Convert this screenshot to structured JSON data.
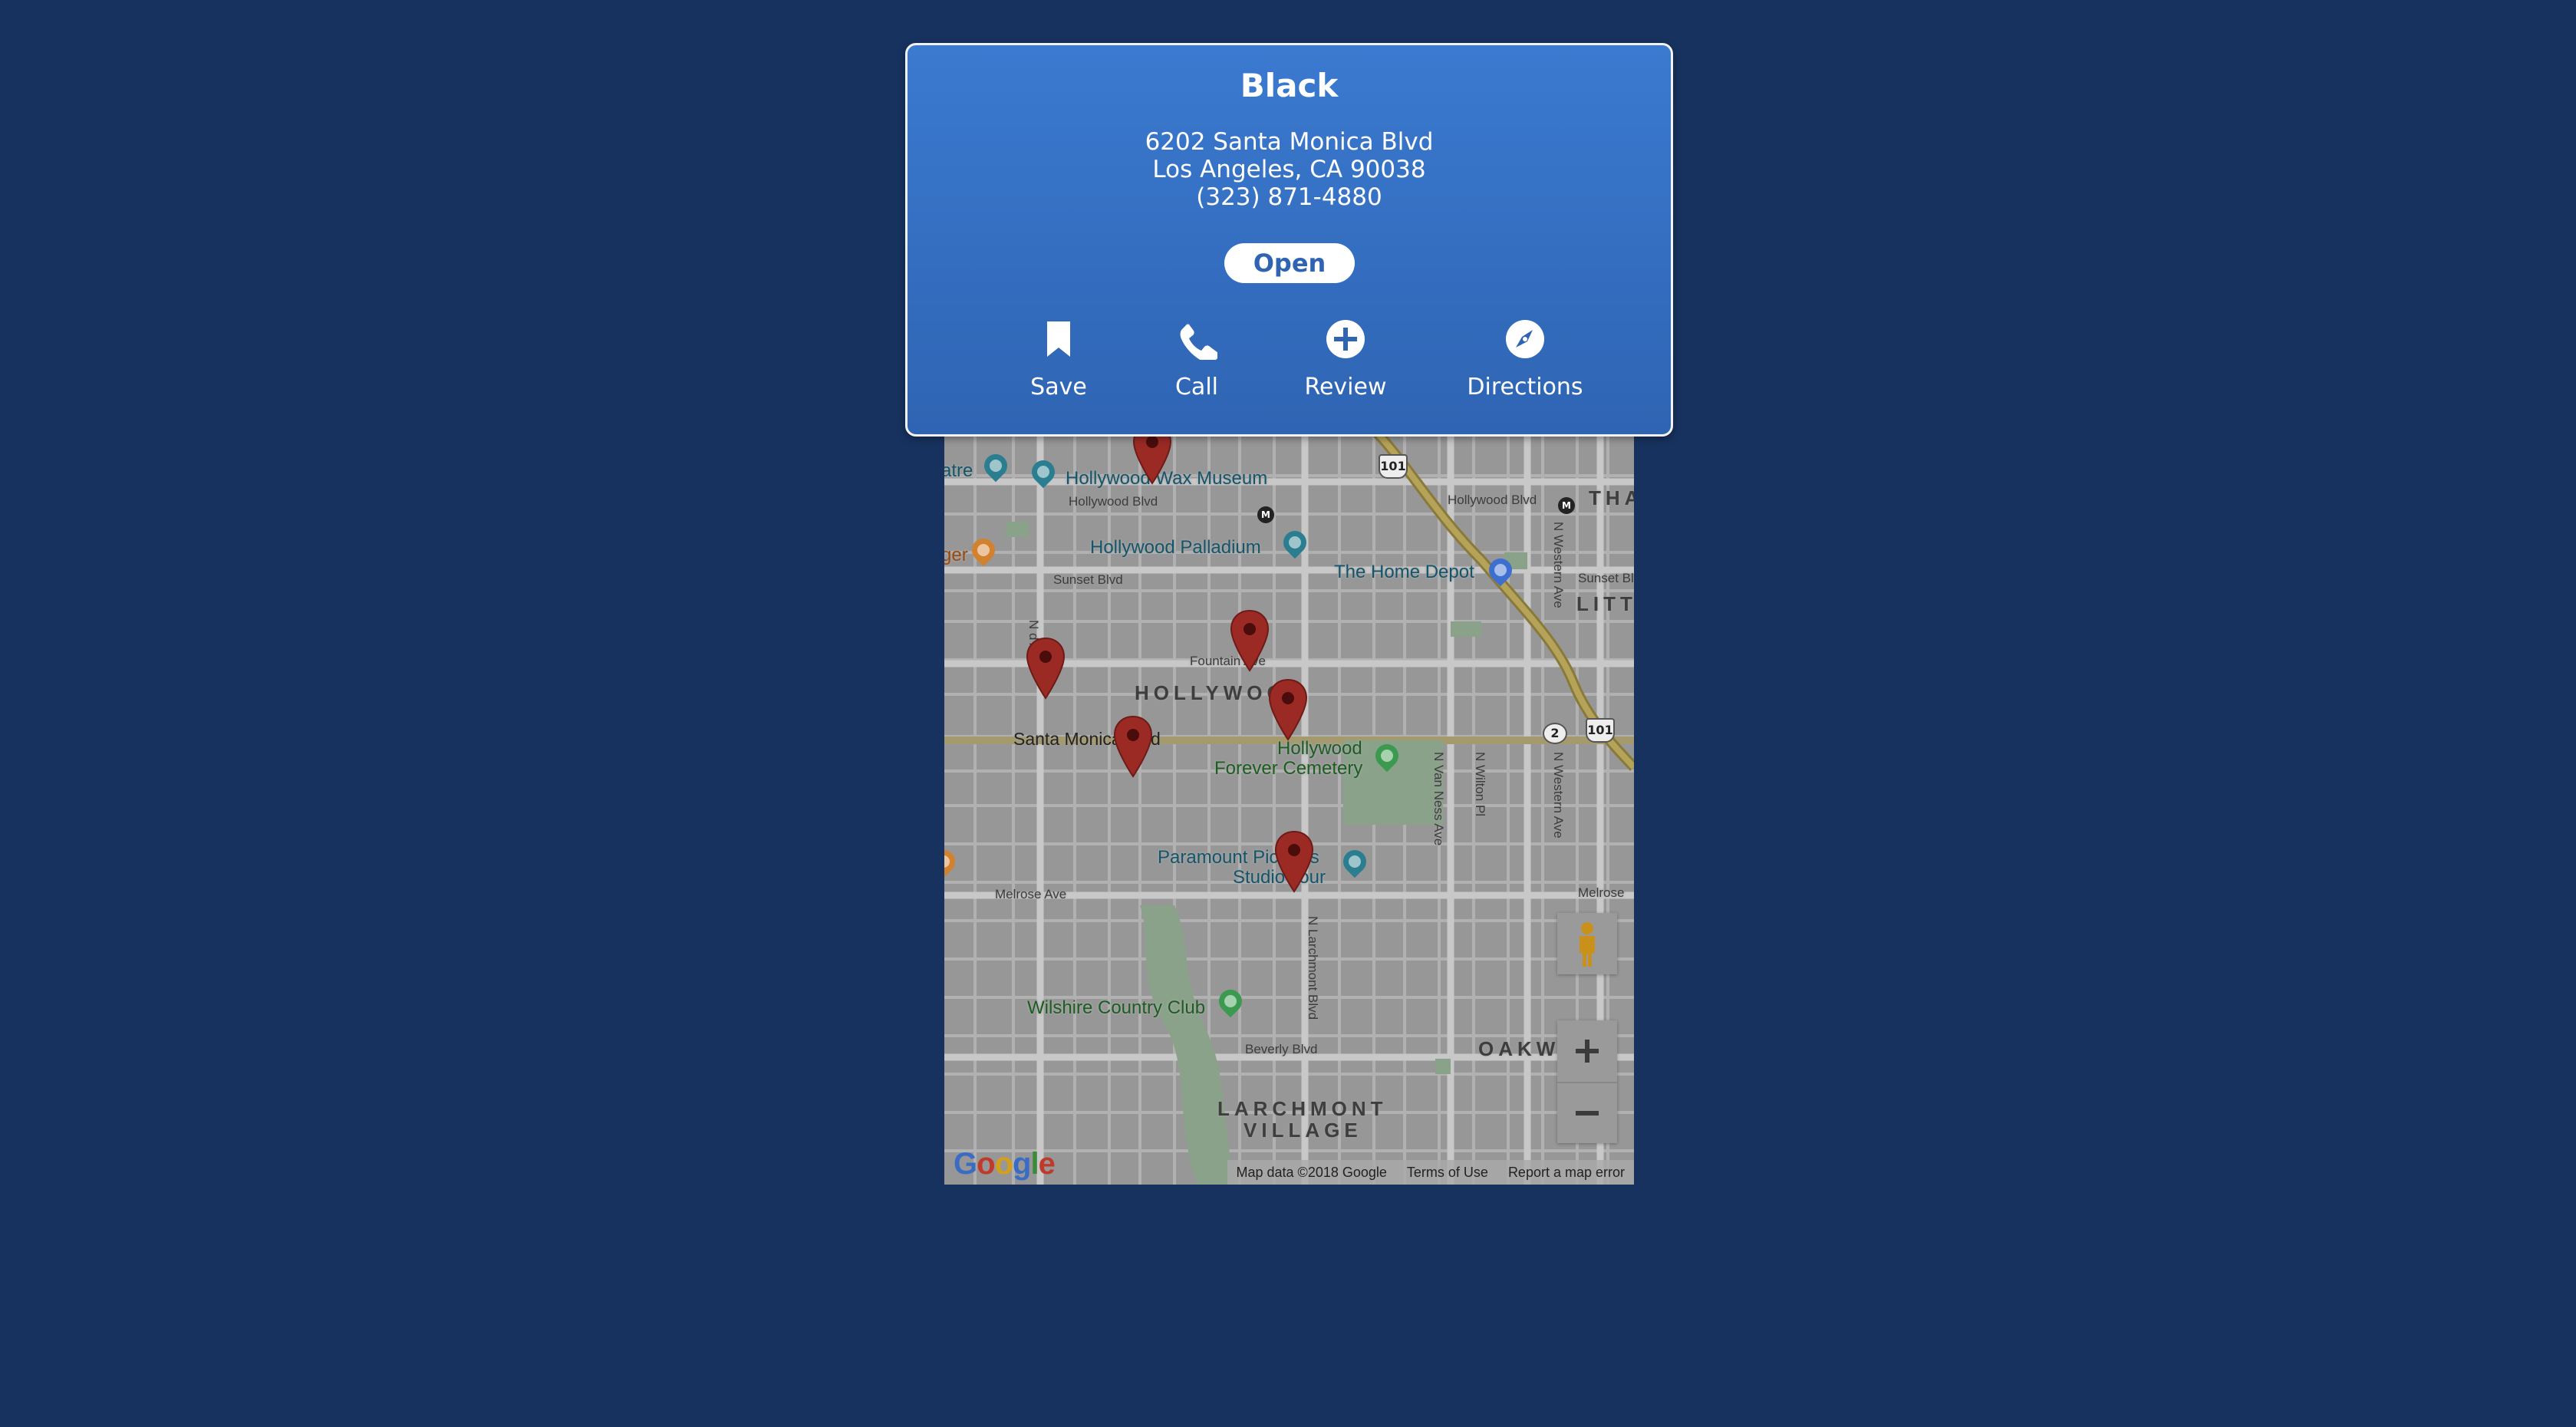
{
  "place": {
    "name": "Black",
    "address_line1": "6202 Santa Monica Blvd",
    "address_line2": "Los Angeles, CA 90038",
    "phone": "(323) 871-4880",
    "status_button": "Open"
  },
  "actions": [
    {
      "label": "Save",
      "icon": "bookmark-icon"
    },
    {
      "label": "Call",
      "icon": "phone-icon"
    },
    {
      "label": "Review",
      "icon": "plus-circle-icon"
    },
    {
      "label": "Directions",
      "icon": "compass-icon"
    }
  ],
  "map": {
    "pois": {
      "wax_museum": "Hollywood Wax Museum",
      "palladium": "Hollywood Palladium",
      "home_depot": "The Home Depot",
      "forever_1": "Hollywood",
      "forever_2": "Forever Cemetery",
      "paramount_1": "Paramount Pictures",
      "paramount_2": "Studio Tour",
      "wilshire": "Wilshire Country Club",
      "theatre_partial": "atre",
      "burger_partial": "ger"
    },
    "streets": {
      "hollywood_blvd_left": "Hollywood Blvd",
      "hollywood_blvd_right": "Hollywood Blvd",
      "sunset_left": "Sunset Blvd",
      "sunset_right": "Sunset Bl",
      "fountain": "Fountain Ave",
      "santa_monica": "Santa Monica Blvd",
      "melrose_left": "Melrose Ave",
      "melrose_right": "Melrose",
      "beverly": "Beverly Blvd",
      "larchmont": "N Larchmont Blvd",
      "van_ness": "N Van Ness Ave",
      "wilton": "N Wilton Pl",
      "western_top": "N Western Ave",
      "western_bottom": "N Western Ave",
      "n_ave_partial": "N        d Ave"
    },
    "neighborhoods": {
      "hollywood": "HOLLYWOOD",
      "oakwood": "OAKW",
      "larchmont_1": "LARCHMONT",
      "larchmont_2": "VILLAGE",
      "thai_partial": "THA",
      "little_partial": "LITT"
    },
    "highways": [
      "101",
      "101",
      "2"
    ],
    "markers": 6,
    "zoom_in": "+",
    "zoom_out": "−",
    "logo": "Google",
    "attribution": [
      "Map data ©2018 Google",
      "Terms of Use",
      "Report a map error"
    ]
  },
  "colors": {
    "page_bg": "#17325f",
    "card_top": "#3a7ad0",
    "card_bottom": "#2f64b3",
    "marker": "#9b2a25"
  }
}
